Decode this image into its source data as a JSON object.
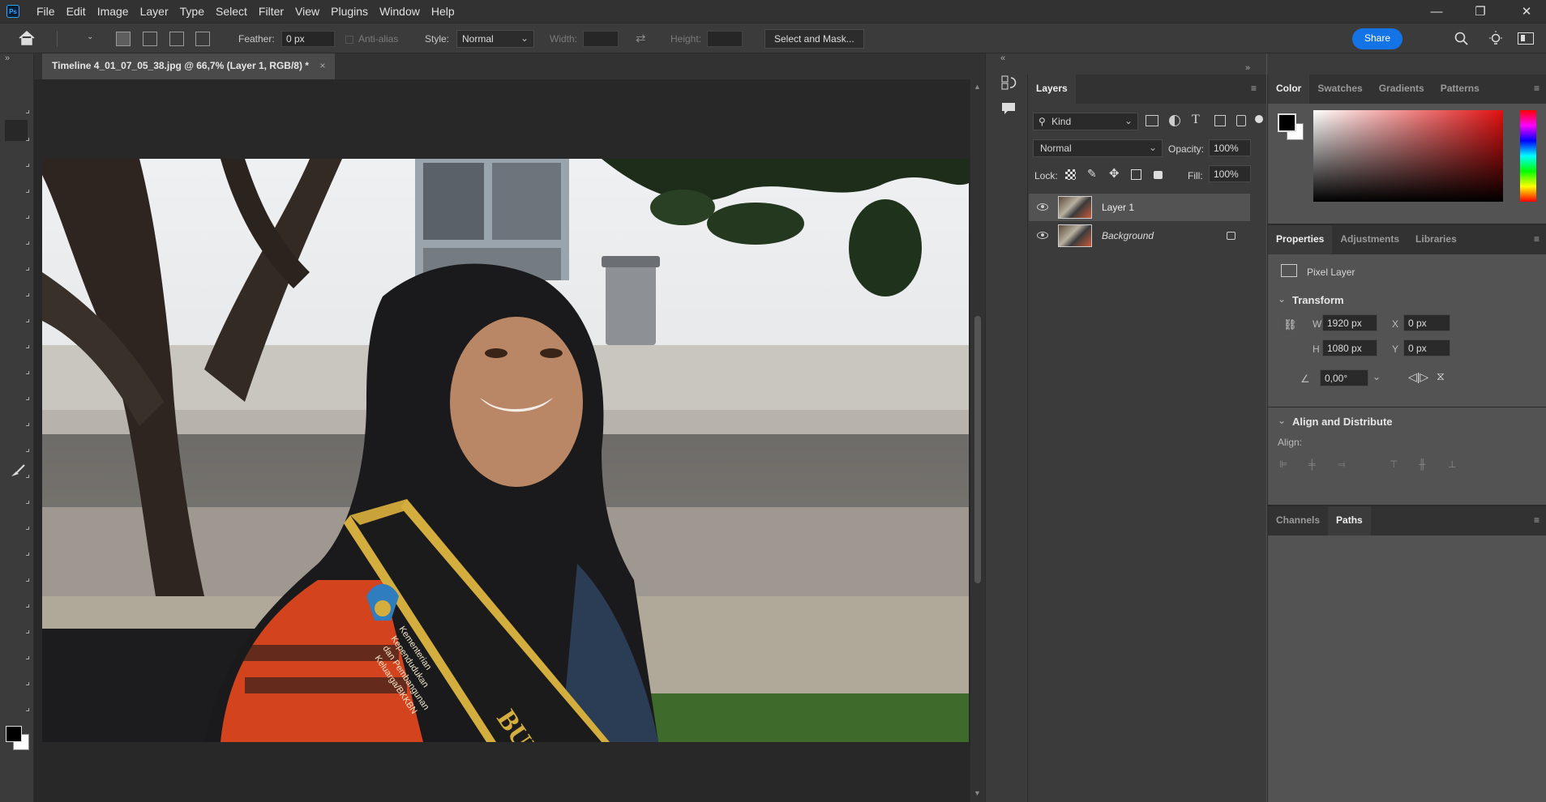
{
  "menubar": {
    "logo": "Ps",
    "items": [
      "File",
      "Edit",
      "Image",
      "Layer",
      "Type",
      "Select",
      "Filter",
      "View",
      "Plugins",
      "Window",
      "Help"
    ]
  },
  "options": {
    "feather_label": "Feather:",
    "feather_value": "0 px",
    "antialias_label": "Anti-alias",
    "style_label": "Style:",
    "style_value": "Normal",
    "width_label": "Width:",
    "height_label": "Height:",
    "select_mask_label": "Select and Mask...",
    "share_label": "Share"
  },
  "document": {
    "tab_title": "Timeline 4_01_07_05_38.jpg @ 66,7% (Layer 1, RGB/8) *",
    "close_glyph": "×",
    "sash_text_1": "Kementerian",
    "sash_text_2": "Kependudukan",
    "sash_text_3": "dan Pembangunan",
    "sash_text_4": "Keluarga/BKKBN",
    "sash_big": "BUND"
  },
  "layers": {
    "tab_label": "Layers",
    "kind_label": "Kind",
    "blend_mode": "Normal",
    "opacity_label": "Opacity:",
    "opacity_value": "100%",
    "lock_label": "Lock:",
    "fill_label": "Fill:",
    "fill_value": "100%",
    "items": [
      {
        "name": "Layer 1",
        "selected": true,
        "locked": false
      },
      {
        "name": "Background",
        "selected": false,
        "locked": true
      }
    ]
  },
  "color_panel": {
    "tabs": [
      "Color",
      "Swatches",
      "Gradients",
      "Patterns"
    ],
    "foreground": "#000000",
    "background": "#ffffff",
    "hue": "#e01010"
  },
  "properties": {
    "tabs": [
      "Properties",
      "Adjustments",
      "Libraries"
    ],
    "layer_type": "Pixel Layer",
    "transform_label": "Transform",
    "w_label": "W",
    "w_value": "1920 px",
    "h_label": "H",
    "h_value": "1080 px",
    "x_label": "X",
    "x_value": "0 px",
    "y_label": "Y",
    "y_value": "0 px",
    "angle_value": "0,00°",
    "align_section": "Align and Distribute",
    "align_label": "Align:"
  },
  "bottom_panel": {
    "tabs": [
      "Channels",
      "Paths"
    ]
  }
}
